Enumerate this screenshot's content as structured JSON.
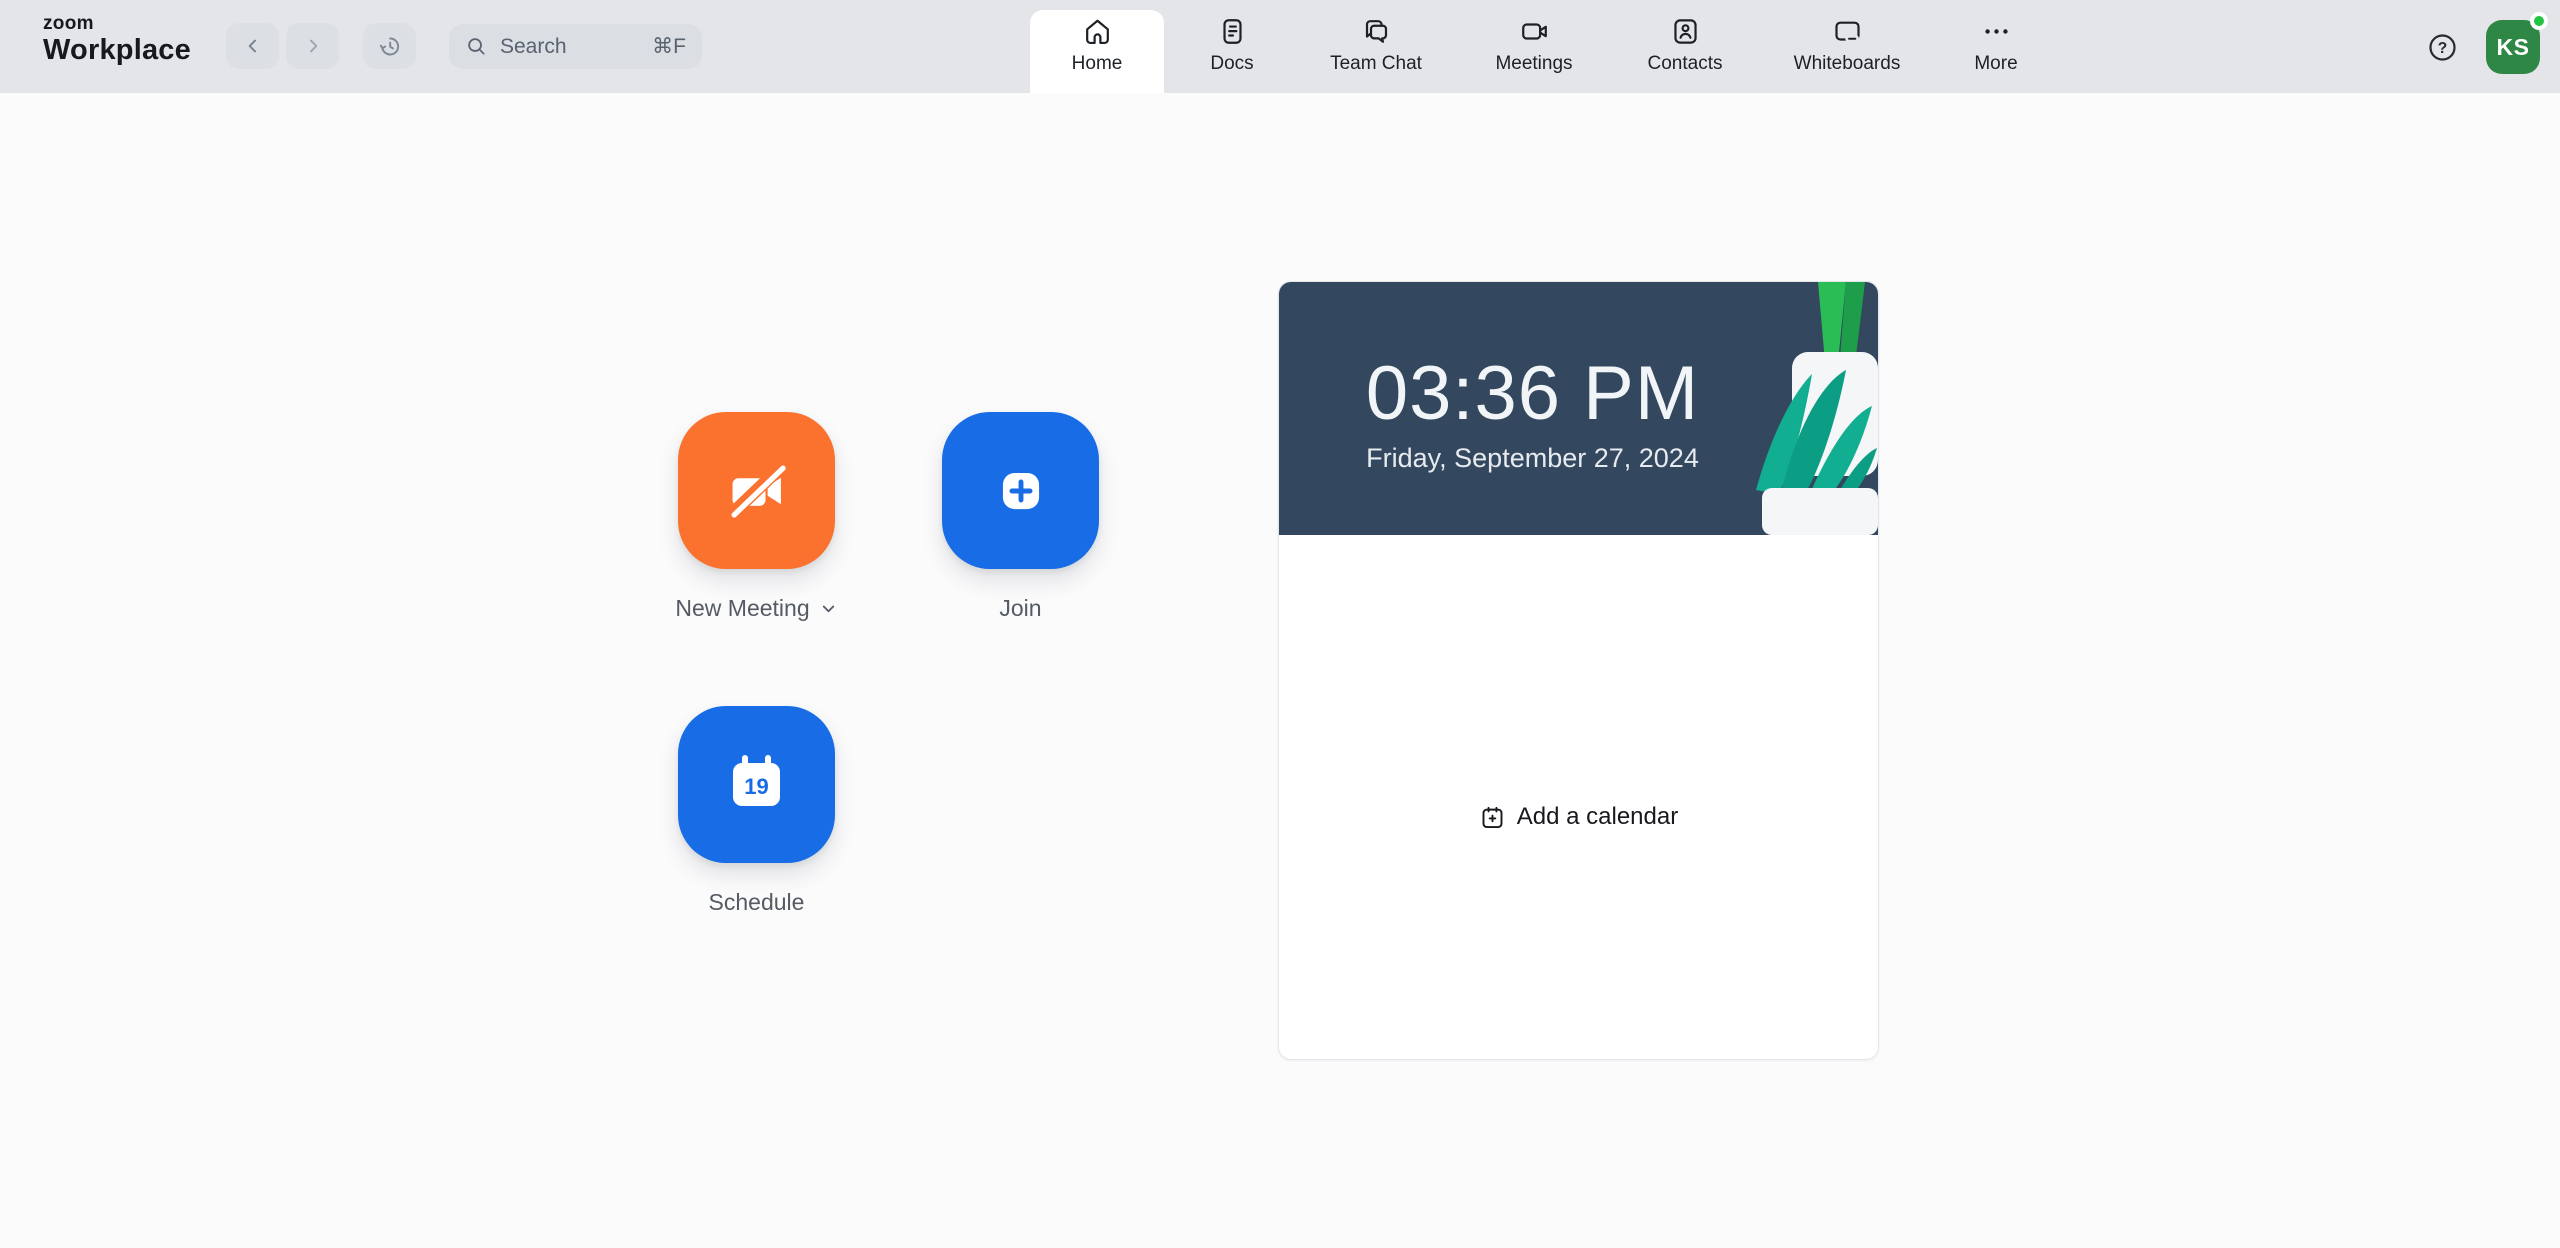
{
  "brand": {
    "line1": "zoom",
    "line2": "Workplace"
  },
  "topbar": {
    "nav": {
      "back_icon": "chevron-left",
      "forward_icon": "chevron-right",
      "history_icon": "history-clock"
    },
    "search": {
      "placeholder": "Search",
      "shortcut": "⌘F"
    },
    "tabs": [
      {
        "label": "Home",
        "icon": "home",
        "active": true
      },
      {
        "label": "Docs",
        "icon": "document",
        "active": false
      },
      {
        "label": "Team Chat",
        "icon": "chat-bubbles",
        "active": false
      },
      {
        "label": "Meetings",
        "icon": "video-camera",
        "active": false
      },
      {
        "label": "Contacts",
        "icon": "person-card",
        "active": false
      },
      {
        "label": "Whiteboards",
        "icon": "whiteboard-marker",
        "active": false
      },
      {
        "label": "More",
        "icon": "ellipsis",
        "active": false
      }
    ],
    "profile": {
      "initials": "KS",
      "status": "online"
    }
  },
  "actions": {
    "new_meeting": {
      "label": "New Meeting",
      "icon": "video-camera-off",
      "has_dropdown": true
    },
    "join": {
      "label": "Join",
      "icon": "plus"
    },
    "schedule": {
      "label": "Schedule",
      "icon": "calendar",
      "day": "19"
    }
  },
  "calendar_card": {
    "time": "03:36 PM",
    "date": "Friday, September 27, 2024",
    "add_calendar_label": "Add a calendar"
  },
  "colors": {
    "topbar_bg": "#E3E5E9",
    "accent_orange": "#FB722F",
    "accent_blue": "#186DE6",
    "header_navy": "#33485E",
    "avatar_green": "#2E8745",
    "presence_green": "#23C343",
    "plant_teal": "#12AE92",
    "plant_green": "#2ABC55"
  }
}
